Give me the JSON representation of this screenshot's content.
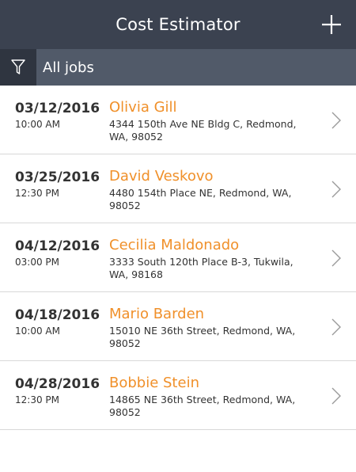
{
  "header": {
    "title": "Cost Estimator"
  },
  "filter": {
    "label": "All jobs"
  },
  "jobs": [
    {
      "date": "03/12/2016",
      "time": "10:00 AM",
      "name": "Olivia Gill",
      "address": "4344 150th Ave NE Bldg C, Redmond, WA, 98052"
    },
    {
      "date": "03/25/2016",
      "time": "12:30 PM",
      "name": "David Veskovo",
      "address": "4480 154th Place NE, Redmond, WA, 98052"
    },
    {
      "date": "04/12/2016",
      "time": "03:00 PM",
      "name": "Cecilia Maldonado",
      "address": "3333 South 120th Place B-3, Tukwila, WA, 98168"
    },
    {
      "date": "04/18/2016",
      "time": "10:00 AM",
      "name": "Mario Barden",
      "address": "15010 NE 36th Street, Redmond, WA, 98052"
    },
    {
      "date": "04/28/2016",
      "time": "12:30 PM",
      "name": "Bobbie Stein",
      "address": "14865 NE 36th Street, Redmond, WA, 98052"
    }
  ],
  "icons": {
    "add": "plus-icon",
    "filter": "filter-funnel-icon",
    "row_chevron": "chevron-right-icon"
  },
  "colors": {
    "header_bg": "#3b4250",
    "filter_bar_bg": "#515a69",
    "filter_icon_bg": "#2f3540",
    "accent_name": "#f0902a"
  }
}
